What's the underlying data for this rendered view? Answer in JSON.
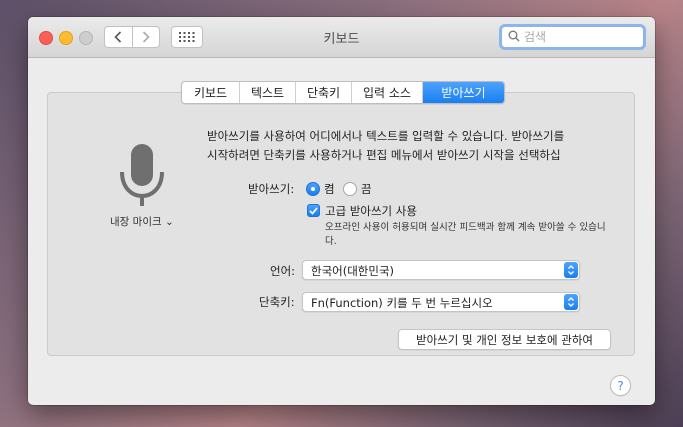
{
  "window": {
    "title": "키보드"
  },
  "search": {
    "placeholder": "검색"
  },
  "tabs": [
    {
      "label": "키보드"
    },
    {
      "label": "텍스트"
    },
    {
      "label": "단축키"
    },
    {
      "label": "입력 소스"
    },
    {
      "label": "받아쓰기",
      "selected": true
    }
  ],
  "dictation": {
    "description_line1": "받아쓰기를 사용하여 어디에서나 텍스트를 입력할 수 있습니다. 받아쓰기를",
    "description_line2": "시작하려면 단축키를 사용하거나 편집 메뉴에서 받아쓰기 시작을 선택하십",
    "mic_source": "내장 마이크 ⌄",
    "toggle_label": "받아쓰기:",
    "option_on": "켬",
    "option_off": "끔",
    "selected": "켬",
    "enhanced_label": "고급 받아쓰기 사용",
    "enhanced_checked": true,
    "enhanced_note": "오프라인 사용이 허용되며 실시간 피드백과 함께 계속 받아쓸 수 있습니다.",
    "language_label": "언어:",
    "language_value": "한국어(대한민국)",
    "shortcut_label": "단축키:",
    "shortcut_value": "Fn(Function) 키를 두 번 누르십시오",
    "privacy_button": "받아쓰기 및 개인 정보 보호에 관하여"
  },
  "help": {
    "label": "?"
  },
  "colors": {
    "accent": "#1a7ef2",
    "close": "#fc5f57",
    "minimize": "#fdbc2e",
    "zoom_disabled": "#cdcdcd"
  },
  "icons": [
    "back-chevron-icon",
    "forward-chevron-icon",
    "grid-icon",
    "search-icon",
    "microphone-icon",
    "stepper-arrows-icon",
    "checkmark-icon"
  ]
}
